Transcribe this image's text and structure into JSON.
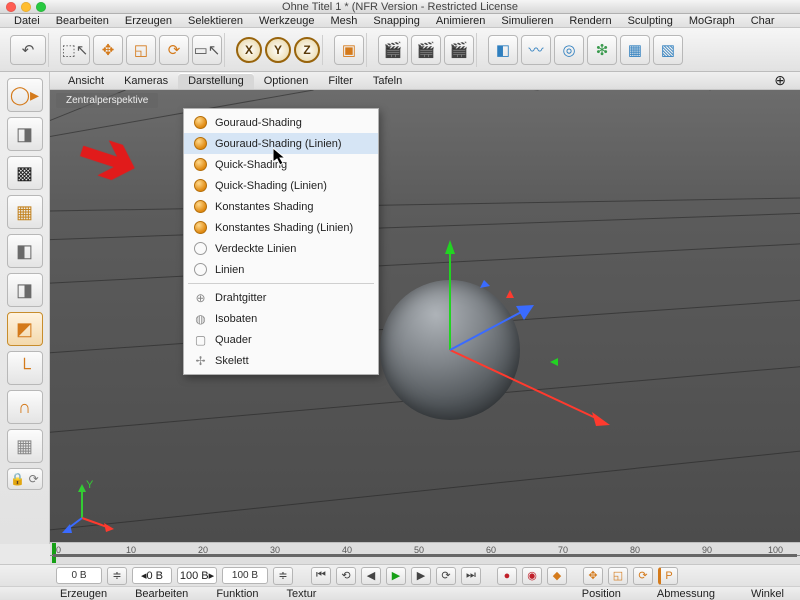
{
  "window": {
    "title": "Ohne Titel 1 * (NFR Version - Restricted License"
  },
  "traffic": {
    "close": "#ff5d52",
    "min": "#ffbd2e",
    "max": "#28c940"
  },
  "main_menu": [
    "Datei",
    "Bearbeiten",
    "Erzeugen",
    "Selektieren",
    "Werkzeuge",
    "Mesh",
    "Snapping",
    "Animieren",
    "Simulieren",
    "Rendern",
    "Sculpting",
    "MoGraph",
    "Char"
  ],
  "viewport_menu": [
    "Ansicht",
    "Kameras",
    "Darstellung",
    "Optionen",
    "Filter",
    "Tafeln"
  ],
  "active_viewport_menu_index": 2,
  "viewport_tag": "Zentralperspektive",
  "dropdown": {
    "group1": [
      "Gouraud-Shading",
      "Gouraud-Shading (Linien)",
      "Quick-Shading",
      "Quick-Shading (Linien)",
      "Konstantes Shading",
      "Konstantes Shading (Linien)",
      "Verdeckte Linien",
      "Linien"
    ],
    "group2": [
      "Drahtgitter",
      "Isobaten",
      "Quader",
      "Skelett"
    ],
    "hover_index": 1
  },
  "axes": {
    "x": "X",
    "y": "Y",
    "z": "Z"
  },
  "timeline": {
    "ticks": [
      "0",
      "10",
      "20",
      "30",
      "40",
      "50",
      "60",
      "70",
      "80",
      "90",
      "100"
    ],
    "current": "0 B",
    "start": "0 B",
    "preview_end": "100 B",
    "end": "100 B"
  },
  "status_left": [
    "Erzeugen",
    "Bearbeiten",
    "Funktion",
    "Textur"
  ],
  "status_right": [
    "Position",
    "Abmessung",
    "Winkel"
  ]
}
